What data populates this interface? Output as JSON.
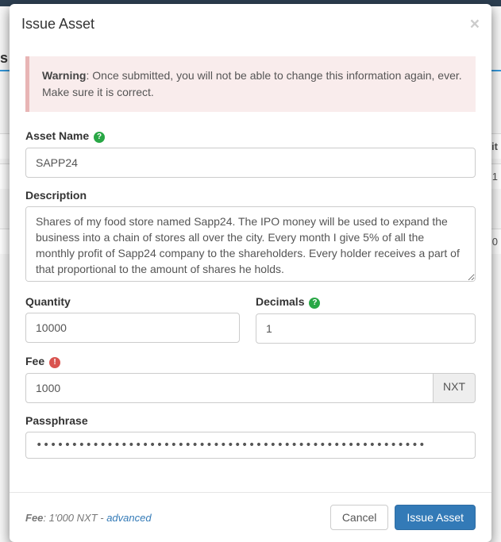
{
  "bg": {
    "qty_header": "ntit",
    "row1": "0",
    "side": "s"
  },
  "modal": {
    "title": "Issue Asset",
    "close": "×"
  },
  "warning": {
    "label": "Warning",
    "text": ": Once submitted, you will not be able to change this information again, ever. Make sure it is correct."
  },
  "fields": {
    "asset_name": {
      "label": "Asset Name",
      "value": "SAPP24"
    },
    "description": {
      "label": "Description",
      "value": "Shares of my food store named Sapp24. The IPO money will be used to expand the business into a chain of stores all over the city. Every month I give 5% of all the monthly profit of Sapp24 company to the shareholders. Every holder receives a part of that proportional to the amount of shares he holds."
    },
    "quantity": {
      "label": "Quantity",
      "value": "10000"
    },
    "decimals": {
      "label": "Decimals",
      "value": "1"
    },
    "fee": {
      "label": "Fee",
      "value": "1000",
      "unit": "NXT"
    },
    "passphrase": {
      "label": "Passphrase",
      "value": "•••••••••••••••••••••••••••••••••••••••••••••••••••••••"
    }
  },
  "footer": {
    "fee_label": "Fee",
    "fee_value": ": 1'000 NXT - ",
    "advanced": "advanced",
    "cancel": "Cancel",
    "submit": "Issue Asset"
  },
  "icons": {
    "help": "?",
    "warn": "!"
  }
}
